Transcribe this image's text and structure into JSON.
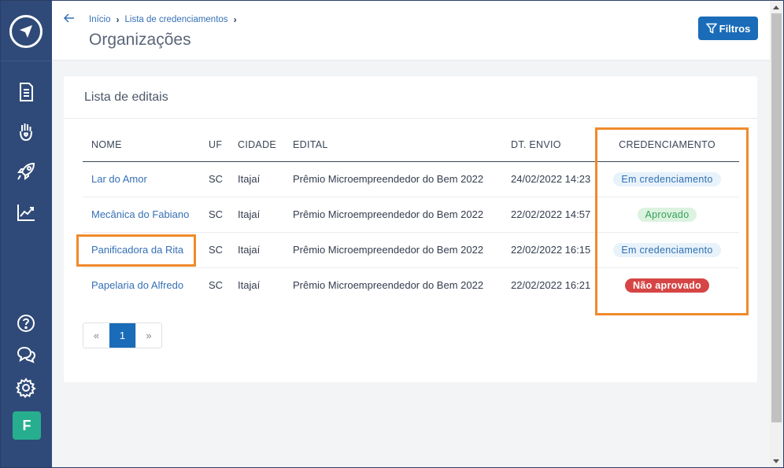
{
  "sidebar": {
    "items": [
      {
        "icon": "document-list-icon"
      },
      {
        "icon": "raised-hand-icon"
      },
      {
        "icon": "rocket-icon"
      },
      {
        "icon": "chart-icon"
      },
      {
        "icon": "help-icon"
      },
      {
        "icon": "chat-icon"
      },
      {
        "icon": "settings-icon"
      }
    ],
    "avatar_letter": "F"
  },
  "header": {
    "breadcrumb": [
      "Início",
      "Lista de credenciamentos"
    ],
    "title": "Organizações",
    "filter_label": "Filtros"
  },
  "card": {
    "title": "Lista de editais",
    "columns": [
      "NOME",
      "UF",
      "CIDADE",
      "EDITAL",
      "DT. ENVIO",
      "CREDENCIAMENTO"
    ],
    "rows": [
      {
        "nome": "Lar do Amor",
        "uf": "SC",
        "cidade": "Itajaí",
        "edital": "Prêmio Microempreendedor do Bem 2022",
        "dt_envio": "24/02/2022 14:23",
        "status": "Em credenciamento",
        "status_type": "info"
      },
      {
        "nome": "Mecânica do Fabiano",
        "uf": "SC",
        "cidade": "Itajaí",
        "edital": "Prêmio Microempreendedor do Bem 2022",
        "dt_envio": "22/02/2022 14:57",
        "status": "Aprovado",
        "status_type": "success"
      },
      {
        "nome": "Panificadora da Rita",
        "uf": "SC",
        "cidade": "Itajaí",
        "edital": "Prêmio Microempreendedor do Bem 2022",
        "dt_envio": "22/02/2022 16:15",
        "status": "Em credenciamento",
        "status_type": "info"
      },
      {
        "nome": "Papelaria do Alfredo",
        "uf": "SC",
        "cidade": "Itajaí",
        "edital": "Prêmio Microempreendedor do Bem 2022",
        "dt_envio": "22/02/2022 16:21",
        "status": "Não aprovado",
        "status_type": "danger"
      }
    ]
  },
  "pagination": {
    "prev": "«",
    "current": "1",
    "next": "»"
  },
  "colors": {
    "sidebar": "#2f4a78",
    "primary": "#1a6cb8",
    "highlight": "#f08a2b",
    "avatar": "#27ae8f"
  }
}
